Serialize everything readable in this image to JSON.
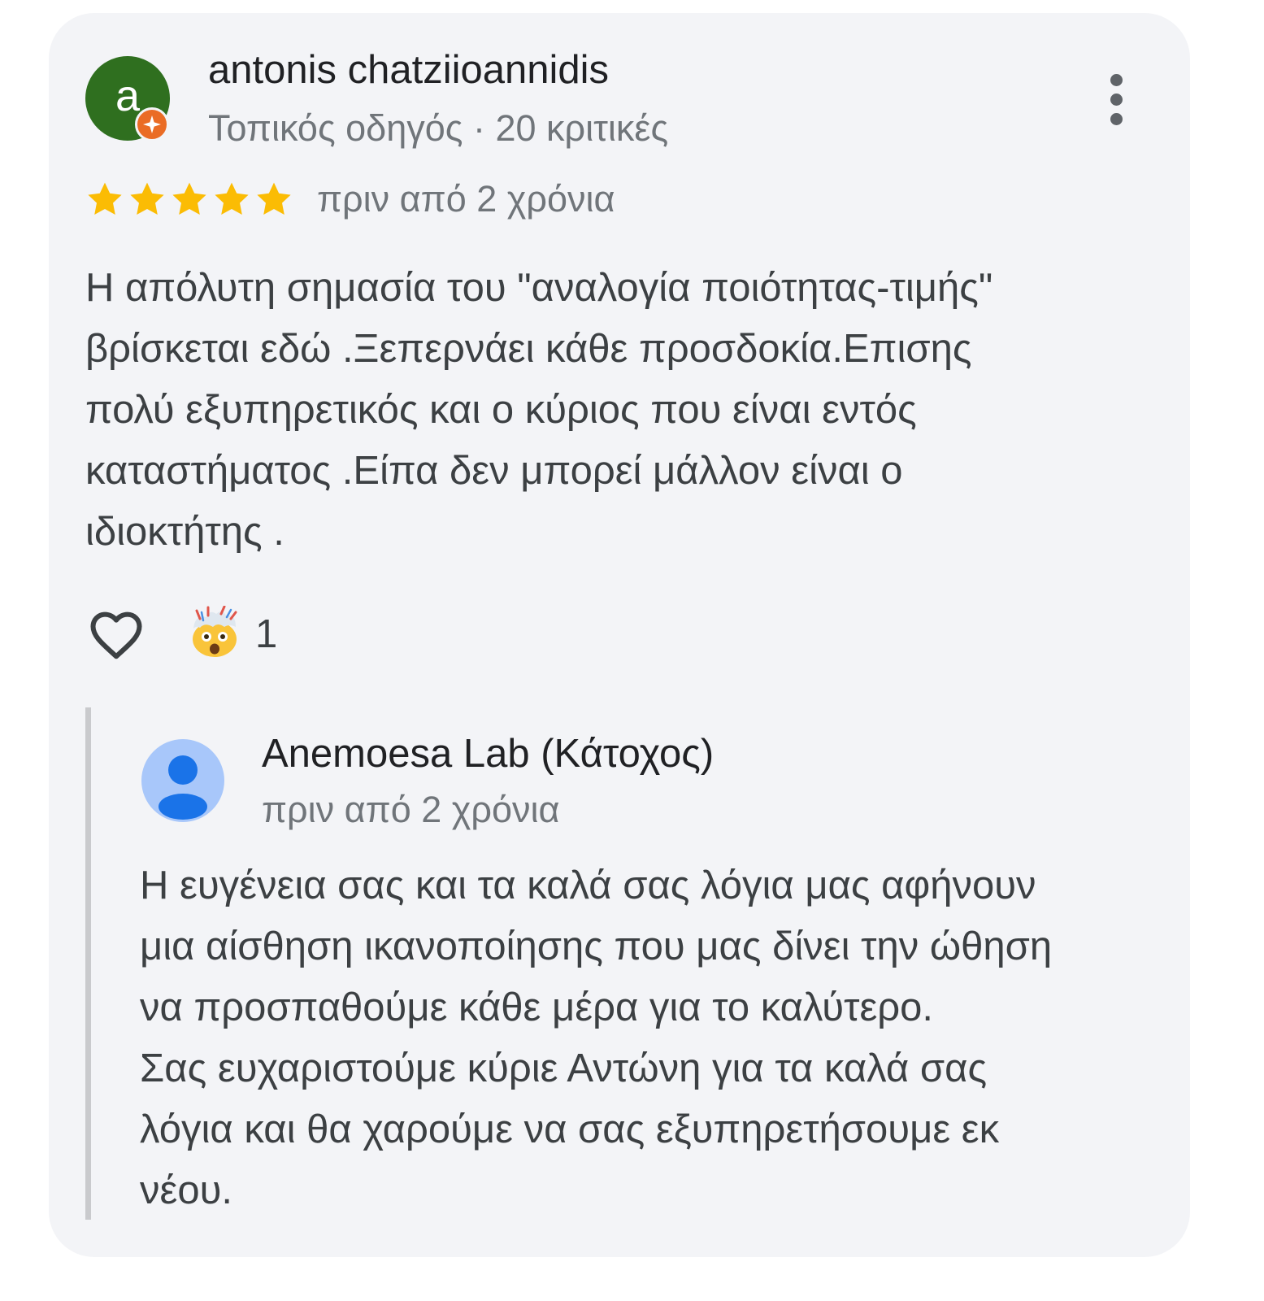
{
  "review": {
    "avatar_letter": "a",
    "avatar_color": "#2f6f1f",
    "badge_icon": "local-guide-badge-icon",
    "badge_color": "#ea6c25",
    "author": "antonis chatziioannidis",
    "meta": "Τοπικός οδηγός · 20 κριτικές",
    "rating": 5,
    "rating_max": 5,
    "star_color": "#fbbc04",
    "date": "πριν από 2 χρόνια",
    "text": "Η απόλυτη σημασία του \"αναλογία ποιότητας-τιμής\"\nβρίσκεται εδώ .Ξεπερνάει κάθε προσδοκία.Επισης\nπολύ εξυπηρετικός και ο κύριος που είναι εντός\nκαταστήματος .Είπα δεν μπορεί μάλλον είναι ο\nιδιοκτήτης .",
    "like_icon": "heart-outline-icon",
    "reaction_icon": "mind-blown-emoji",
    "reaction_count": "1",
    "menu_icon": "more-vertical-icon"
  },
  "reply": {
    "owner_avatar_icon": "person-avatar-icon",
    "owner_avatar_color": "#a8c7fa",
    "owner_name": "Anemoesa Lab (Κάτοχος)",
    "date": "πριν από 2 χρόνια",
    "text": "Η ευγένεια σας και τα καλά σας λόγια μας αφήνουν\nμια αίσθηση ικανοποίησης που μας δίνει την ώθηση\nνα προσπαθούμε κάθε μέρα για το καλύτερο.\nΣας ευχαριστούμε κύριε Αντώνη για τα καλά σας\nλόγια και θα χαρούμε να σας εξυπηρετήσουμε εκ\nνέου."
  }
}
